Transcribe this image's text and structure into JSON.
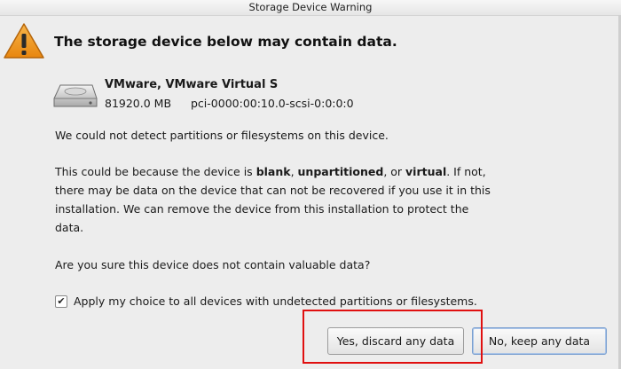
{
  "window": {
    "title": "Storage Device Warning"
  },
  "heading": "The storage device below may contain data.",
  "device": {
    "name": "VMware, VMware Virtual S",
    "size": "81920.0 MB",
    "path": "pci-0000:00:10.0-scsi-0:0:0:0"
  },
  "messages": {
    "no_partitions": "We could not detect partitions or filesystems on this device.",
    "cause_prefix": "This could be because the device is ",
    "cause_blank": "blank",
    "cause_sep1": ", ",
    "cause_unpartitioned": "unpartitioned",
    "cause_sep2": ", or ",
    "cause_virtual": "virtual",
    "cause_suffix": ". If not, there may be data on the device that can not be recovered if you use it in this installation. We can remove the device from this installation to protect the data.",
    "question": "Are you sure this device does not contain valuable data?"
  },
  "apply_all": {
    "checked": true,
    "mark": "✔",
    "label": "Apply my choice to all devices with undetected partitions or filesystems."
  },
  "buttons": {
    "yes": "Yes, discard any data",
    "no": "No, keep any data"
  },
  "colors": {
    "warning_fill": "#f29a1d",
    "highlight": "#e01010",
    "background": "#ededed"
  },
  "icons": {
    "warning": "warning-triangle-icon",
    "disk": "hard-disk-icon"
  }
}
